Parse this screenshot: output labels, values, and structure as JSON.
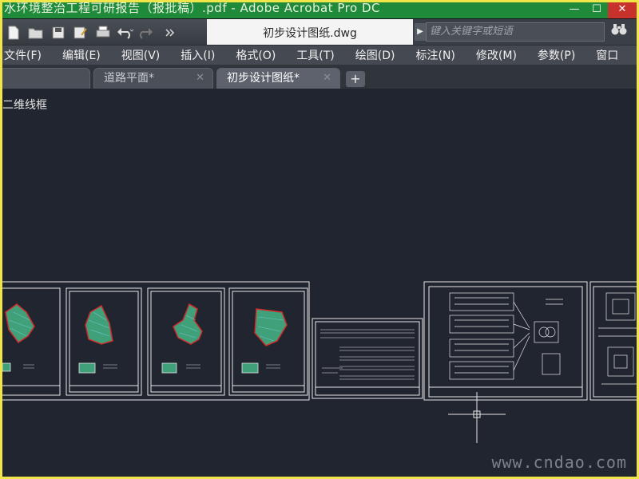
{
  "window": {
    "title_partial": "水环境整治工程可研报告（报批稿）.pdf - Adobe Acrobat Pro DC",
    "minimize": "—",
    "maximize": "☐",
    "close": "✕"
  },
  "quick_access": {
    "icons": [
      "new-file-icon",
      "open-folder-icon",
      "save-icon",
      "save-as-icon",
      "print-icon",
      "undo-icon",
      "redo-icon",
      "more-icon"
    ],
    "doc_title": "初步设计图纸.dwg",
    "search_placeholder": "键入关键字或短语"
  },
  "menu": {
    "items": [
      "文件(F)",
      "编辑(E)",
      "视图(V)",
      "插入(I)",
      "格式(O)",
      "工具(T)",
      "绘图(D)",
      "标注(N)",
      "修改(M)",
      "参数(P)",
      "窗口"
    ]
  },
  "tabs": {
    "items": [
      {
        "label": ""
      },
      {
        "label": "道路平面*"
      },
      {
        "label": "初步设计图纸*"
      }
    ],
    "add": "+"
  },
  "canvas": {
    "view_label": "二维线框",
    "watermark": "www.cndao.com"
  },
  "colors": {
    "canvas_bg": "#212530",
    "frame_border": "#f0e64a",
    "map_fill": "#3fa07a",
    "map_outline": "#d22a2a"
  }
}
